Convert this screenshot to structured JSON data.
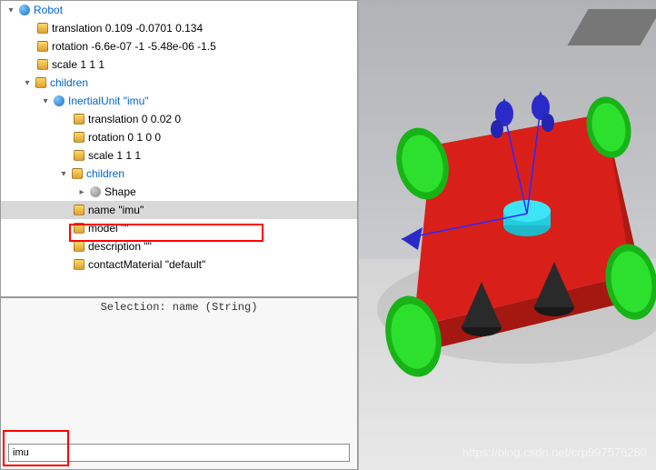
{
  "tree": {
    "robot": {
      "label": "Robot",
      "translation": "translation 0.109 -0.0701 0.134",
      "rotation": "rotation -6.6e-07 -1 -5.48e-06 -1.5",
      "scale": "scale 1 1 1",
      "children_label": "children",
      "imu": {
        "label": "InertialUnit \"imu\"",
        "translation": "translation 0 0.02 0",
        "rotation": "rotation 0 1 0 0",
        "scale": "scale 1 1 1",
        "children_label": "children",
        "shape": "Shape",
        "name": "name \"imu\"",
        "model": "model \"\"",
        "description": "description \"\"",
        "contactMaterial": "contactMaterial \"default\""
      }
    }
  },
  "bottom": {
    "selection_label": "Selection: name (String)",
    "input_value": "imu"
  },
  "watermark": "https://blog.csdn.net/crp997576280"
}
